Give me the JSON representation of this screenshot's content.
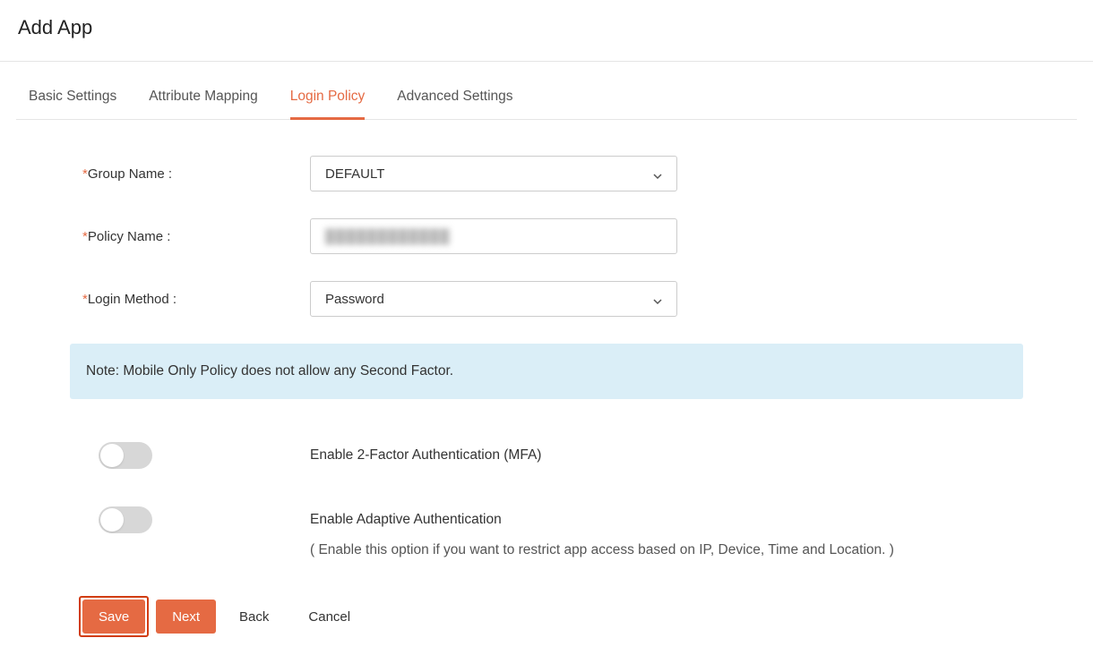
{
  "header": {
    "title": "Add App"
  },
  "tabs": [
    {
      "label": "Basic Settings",
      "active": false
    },
    {
      "label": "Attribute Mapping",
      "active": false
    },
    {
      "label": "Login Policy",
      "active": true
    },
    {
      "label": "Advanced Settings",
      "active": false
    }
  ],
  "form": {
    "group_name": {
      "label": "Group Name :",
      "value": "DEFAULT"
    },
    "policy_name": {
      "label": "Policy Name :",
      "value": "████████████"
    },
    "login_method": {
      "label": "Login Method :",
      "value": "Password"
    }
  },
  "note": "Note: Mobile Only Policy does not allow any Second Factor.",
  "toggles": {
    "mfa": {
      "label": "Enable 2-Factor Authentication (MFA)",
      "on": false
    },
    "adaptive": {
      "label": "Enable Adaptive Authentication",
      "sub": "( Enable this option if you want to restrict app access based on IP, Device, Time and Location. )",
      "on": false
    }
  },
  "buttons": {
    "save": "Save",
    "next": "Next",
    "back": "Back",
    "cancel": "Cancel"
  }
}
